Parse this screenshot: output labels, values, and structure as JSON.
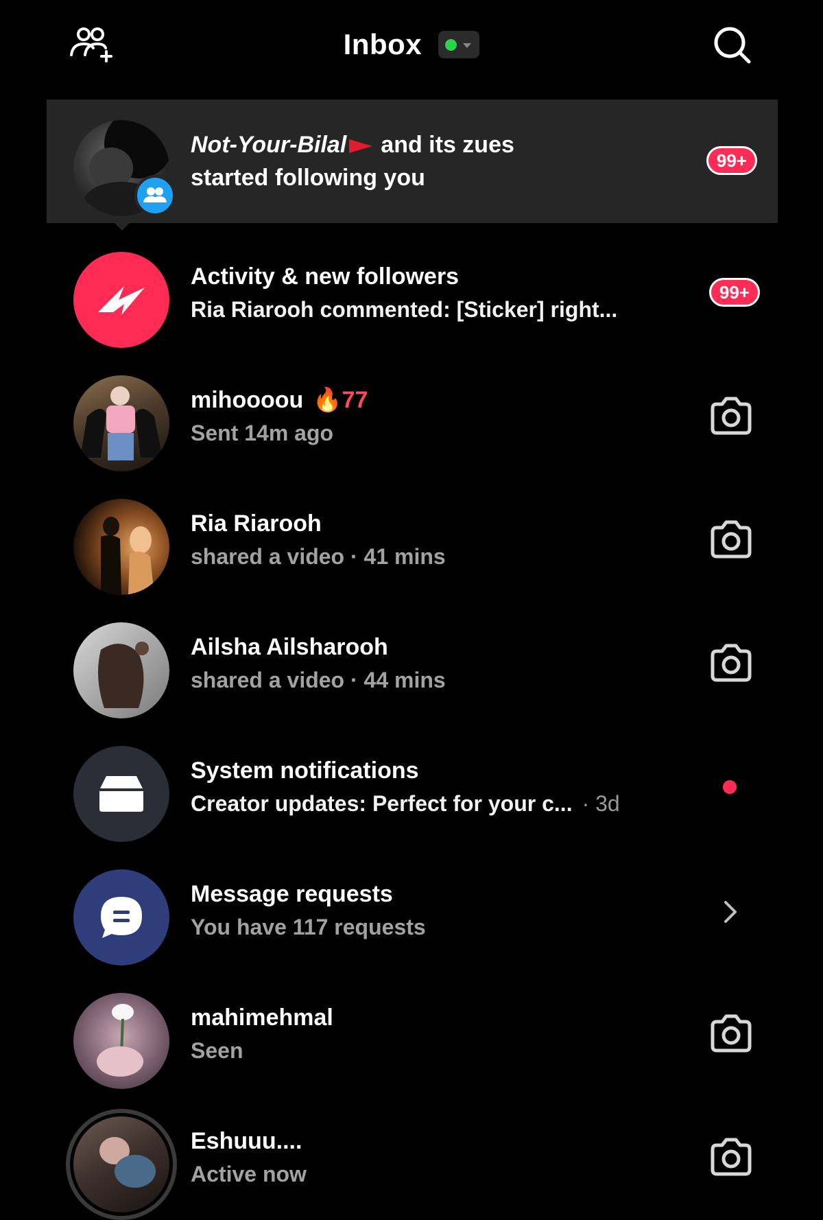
{
  "header": {
    "title": "Inbox",
    "left_icon": "add-friends-icon",
    "right_icon": "search-icon",
    "status_color": "#2bd44a"
  },
  "rows": [
    {
      "name_italic": "Not-Your-Bilal",
      "name_rest": "and its zues",
      "subtitle": "started following you",
      "badge": "99+",
      "avatar_badge_icon": "group-icon"
    },
    {
      "title": "Activity & new followers",
      "subtitle": "Ria Riarooh commented: [Sticker] right...",
      "badge": "99+",
      "icon": "lightning-icon",
      "icon_bg": "#fe2c55"
    },
    {
      "title": "mihoooou",
      "streak": "77",
      "subtitle": "Sent 14m ago",
      "action_icon": "camera-icon"
    },
    {
      "title": "Ria Riarooh",
      "subtitle": "shared a video · 41 mins",
      "action_icon": "camera-icon"
    },
    {
      "title": "Ailsha Ailsharooh",
      "subtitle": "shared a video · 44 mins",
      "action_icon": "camera-icon"
    },
    {
      "title": "System notifications",
      "subtitle": "Creator updates: Perfect for your c...",
      "time": "· 3d",
      "icon": "inbox-tray-icon",
      "icon_bg": "#2a2e36"
    },
    {
      "title": "Message requests",
      "subtitle": "You have 117 requests",
      "icon": "chat-bubble-icon",
      "icon_bg": "#2f3d7a"
    },
    {
      "title": "mahimehmal",
      "subtitle": "Seen",
      "action_icon": "camera-icon"
    },
    {
      "title": "Eshuuu....",
      "subtitle": "Active now",
      "action_icon": "camera-icon"
    }
  ]
}
